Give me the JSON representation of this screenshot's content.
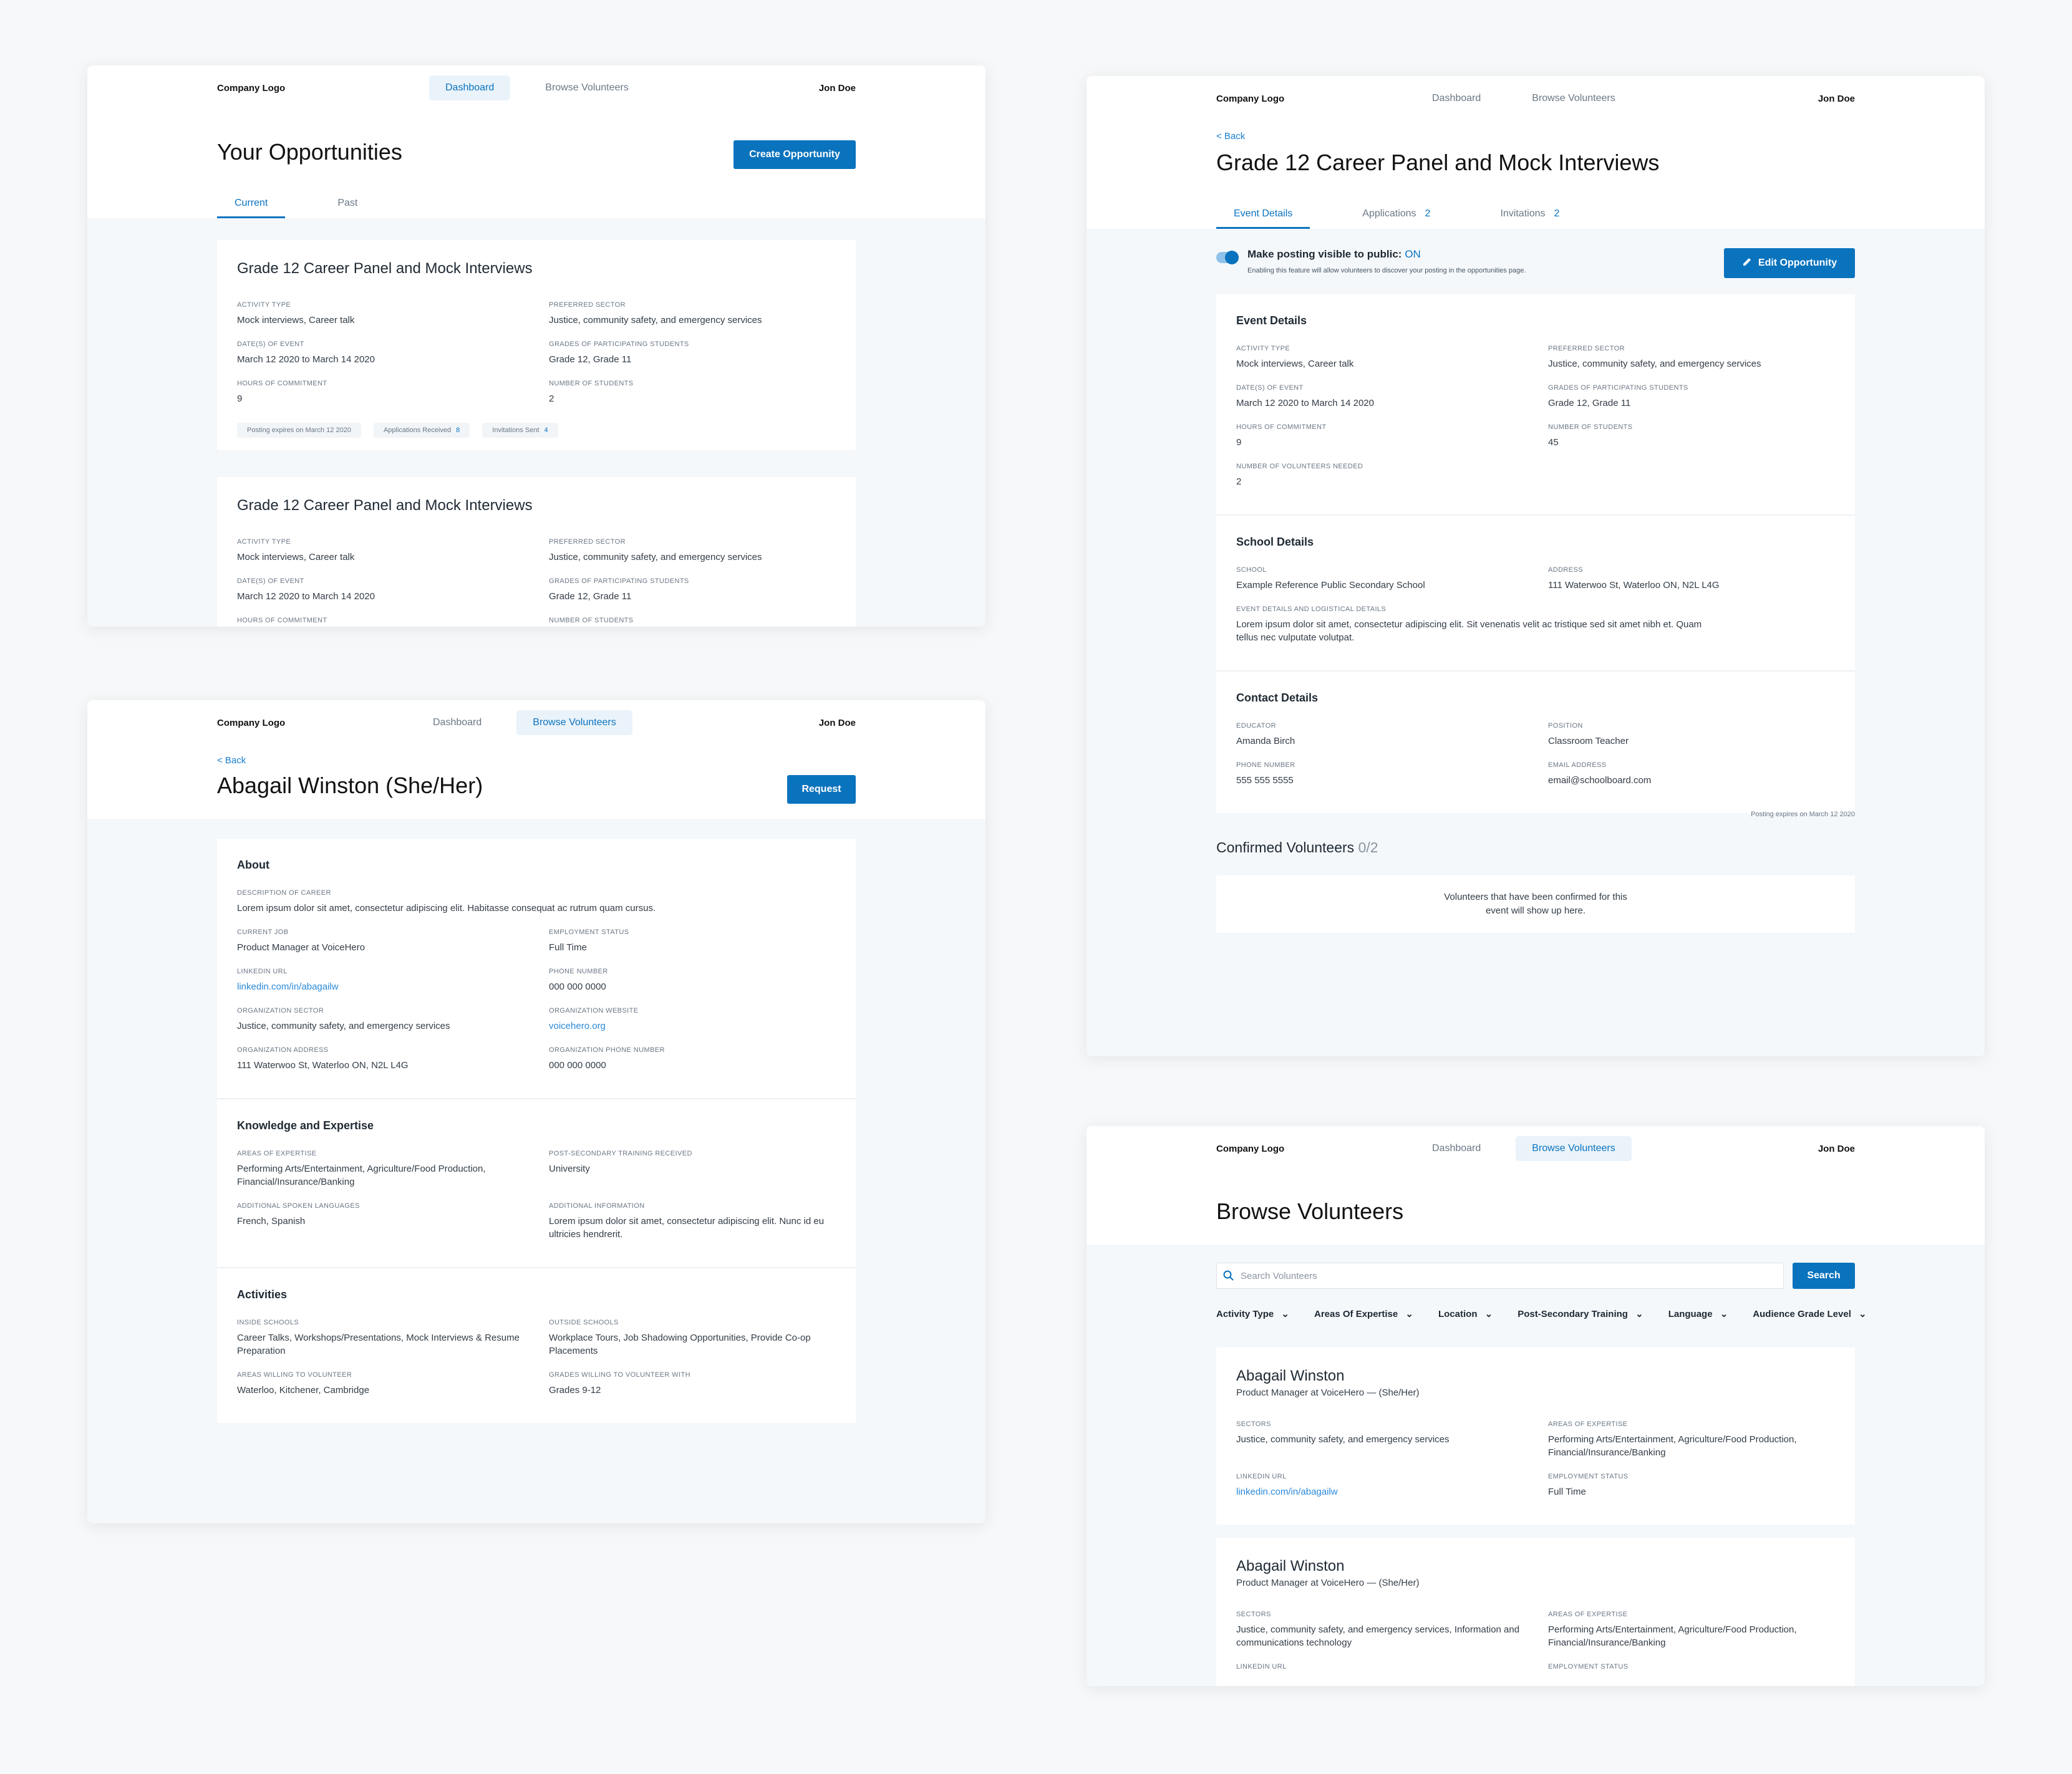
{
  "common": {
    "logo": "Company Logo",
    "user": "Jon Doe",
    "nav_dashboard": "Dashboard",
    "nav_browse": "Browse Volunteers",
    "back": "< Back"
  },
  "opportunities": {
    "title": "Your Opportunities",
    "create_button": "Create Opportunity",
    "tabs": [
      "Current",
      "Past"
    ],
    "cards": [
      {
        "title": "Grade 12 Career Panel and Mock Interviews",
        "fields": [
          {
            "label": "Activity Type",
            "value": "Mock interviews, Career talk"
          },
          {
            "label": "Preferred Sector",
            "value": "Justice, community safety, and emergency services"
          },
          {
            "label": "Date(s) of Event",
            "value": "March 12 2020 to March 14 2020"
          },
          {
            "label": "Grades of Participating Students",
            "value": "Grade 12, Grade 11"
          },
          {
            "label": "Hours of Commitment",
            "value": "9"
          },
          {
            "label": "Number of Students",
            "value": "2"
          }
        ],
        "pills": [
          {
            "text": "Posting expires on March 12 2020",
            "count": ""
          },
          {
            "text": "Applications Received",
            "count": "8"
          },
          {
            "text": "Invitations Sent",
            "count": "4"
          }
        ]
      },
      {
        "title": "Grade 12 Career Panel and Mock Interviews",
        "fields": [
          {
            "label": "Activity Type",
            "value": "Mock interviews, Career talk"
          },
          {
            "label": "Preferred Sector",
            "value": "Justice, community safety, and emergency services"
          },
          {
            "label": "Date(s) of Event",
            "value": "March 12 2020 to March 14 2020"
          },
          {
            "label": "Grades of Participating Students",
            "value": "Grade 12, Grade 11"
          },
          {
            "label": "Hours of Commitment",
            "value": ""
          },
          {
            "label": "Number of Students",
            "value": ""
          }
        ]
      }
    ]
  },
  "event": {
    "title": "Grade 12 Career Panel and Mock Interviews",
    "tabs": [
      {
        "label": "Event Details",
        "count": ""
      },
      {
        "label": "Applications",
        "count": "2"
      },
      {
        "label": "Invitations",
        "count": "2"
      }
    ],
    "visibility_label": "Make posting visible to public:",
    "visibility_state": "ON",
    "visibility_note": "Enabling this feature will allow volunteers to discover your posting in the opportunities page.",
    "edit_button": "Edit Opportunity",
    "sections": [
      {
        "title": "Event Details",
        "fields": [
          {
            "label": "Activity Type",
            "value": "Mock interviews, Career talk"
          },
          {
            "label": "Preferred Sector",
            "value": "Justice, community safety, and emergency services"
          },
          {
            "label": "Date(s) of Event",
            "value": "March 12 2020 to March 14 2020"
          },
          {
            "label": "Grades of Participating Students",
            "value": "Grade 12, Grade 11"
          },
          {
            "label": "Hours of Commitment",
            "value": "9"
          },
          {
            "label": "Number of Students",
            "value": "45"
          },
          {
            "label": "Number of Volunteers Needed",
            "value": "2"
          }
        ]
      },
      {
        "title": "School Details",
        "fields": [
          {
            "label": "School",
            "value": "Example Reference Public Secondary School"
          },
          {
            "label": "Address",
            "value": "111 Waterwoo St, Waterloo ON, N2L L4G"
          },
          {
            "label": "Event Details and Logistical Details",
            "value": "Lorem ipsum dolor sit amet, consectetur adipiscing elit. Sit venenatis velit ac tristique sed sit amet nibh et. Quam tellus nec vulputate volutpat.",
            "full": true
          }
        ]
      },
      {
        "title": "Contact Details",
        "fields": [
          {
            "label": "Educator",
            "value": "Amanda Birch"
          },
          {
            "label": "Position",
            "value": "Classroom Teacher"
          },
          {
            "label": "Phone Number",
            "value": "555 555 5555"
          },
          {
            "label": "Email Address",
            "value": "email@schoolboard.com"
          }
        ]
      }
    ],
    "expires": "Posting expires on March 12 2020",
    "confirmed_title": "Confirmed Volunteers",
    "confirmed_count": "0/2",
    "confirmed_empty": "Volunteers that have been confirmed for this event will show up here."
  },
  "profile": {
    "title": "Abagail Winston (She/Her)",
    "request_button": "Request",
    "sections": [
      {
        "title": "About",
        "fields": [
          {
            "label": "Description of Career",
            "value": "Lorem ipsum dolor sit amet, consectetur adipiscing elit. Habitasse consequat ac rutrum quam cursus.",
            "full": true
          },
          {
            "label": "Current Job",
            "value": "Product Manager at VoiceHero"
          },
          {
            "label": "Employment Status",
            "value": "Full Time"
          },
          {
            "label": "LinkedIn URL",
            "value": "linkedin.com/in/abagailw",
            "link": true
          },
          {
            "label": "Phone Number",
            "value": "000 000 0000"
          },
          {
            "label": "Organization Sector",
            "value": "Justice, community safety, and emergency services"
          },
          {
            "label": "Organization Website",
            "value": "voicehero.org",
            "link": true
          },
          {
            "label": "Organization Address",
            "value": "111 Waterwoo St, Waterloo ON, N2L L4G"
          },
          {
            "label": "Organization Phone Number",
            "value": "000 000 0000"
          }
        ]
      },
      {
        "title": "Knowledge and Expertise",
        "fields": [
          {
            "label": "Areas of Expertise",
            "value": "Performing Arts/Entertainment, Agriculture/Food Production, Financial/Insurance/Banking"
          },
          {
            "label": "Post-Secondary Training Received",
            "value": "University"
          },
          {
            "label": "Additional Spoken Languages",
            "value": "French, Spanish"
          },
          {
            "label": "Additional Information",
            "value": "Lorem ipsum dolor sit amet, consectetur adipiscing elit. Nunc id eu ultricies hendrerit."
          }
        ]
      },
      {
        "title": "Activities",
        "fields": [
          {
            "label": "Inside Schools",
            "value": "Career Talks, Workshops/Presentations, Mock Interviews & Resume Preparation"
          },
          {
            "label": "Outside Schools",
            "value": "Workplace Tours, Job Shadowing Opportunities, Provide Co-op Placements"
          },
          {
            "label": "Areas Willing to Volunteer",
            "value": "Waterloo, Kitchener, Cambridge"
          },
          {
            "label": "Grades Willing to Volunteer With",
            "value": "Grades 9-12"
          }
        ]
      }
    ]
  },
  "browse": {
    "title": "Browse Volunteers",
    "search_placeholder": "Search Volunteers",
    "search_button": "Search",
    "filters": [
      "Activity Type",
      "Areas Of Expertise",
      "Location",
      "Post-Secondary Training",
      "Language",
      "Audience Grade Level"
    ],
    "volunteers": [
      {
        "name": "Abagail Winston",
        "subtitle": "Product Manager at VoiceHero — (She/Her)",
        "fields": [
          {
            "label": "Sectors",
            "value": "Justice, community safety, and emergency services"
          },
          {
            "label": "Areas of Expertise",
            "value": "Performing Arts/Entertainment, Agriculture/Food Production, Financial/Insurance/Banking"
          },
          {
            "label": "LinkedIn URL",
            "value": "linkedin.com/in/abagailw",
            "link": true
          },
          {
            "label": "Employment Status",
            "value": "Full Time"
          }
        ]
      },
      {
        "name": "Abagail Winston",
        "subtitle": "Product Manager at VoiceHero — (She/Her)",
        "fields": [
          {
            "label": "Sectors",
            "value": "Justice, community safety, and emergency services, Information and communications technology"
          },
          {
            "label": "Areas of Expertise",
            "value": "Performing Arts/Entertainment, Agriculture/Food Production, Financial/Insurance/Banking"
          },
          {
            "label": "LinkedIn URL",
            "value": "",
            "link": true
          },
          {
            "label": "Employment Status",
            "value": ""
          }
        ]
      }
    ]
  },
  "colors": {
    "accent": "#0a73be",
    "link": "#2b8ad9",
    "background": "#f7f8f9"
  }
}
